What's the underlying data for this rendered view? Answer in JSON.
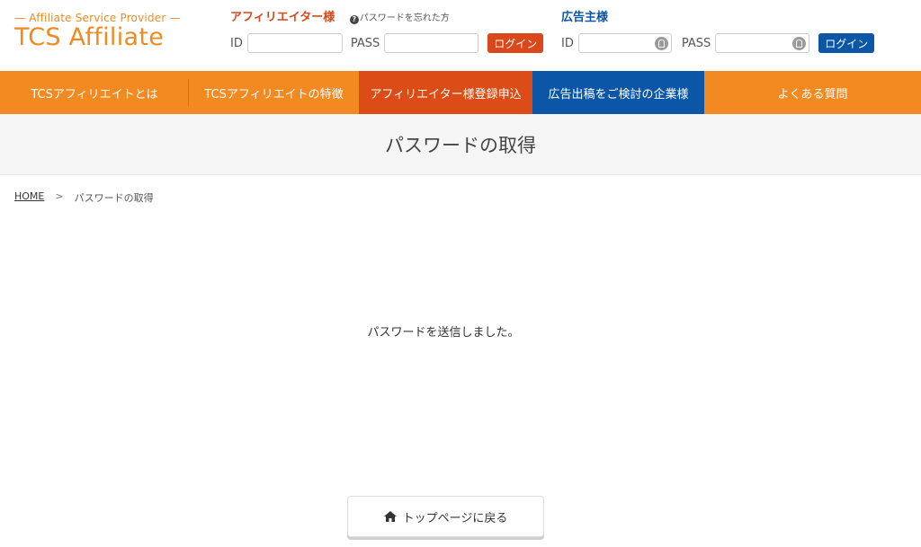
{
  "logo": {
    "sub": "— Affiliate Service Provider —",
    "main": "TCS Affiliate"
  },
  "affiliate_login": {
    "title": "アフィリエイター様",
    "forgot": "パスワードを忘れた方",
    "id_label": "ID",
    "pass_label": "PASS",
    "id_value": "",
    "pass_value": "",
    "login_label": "ログイン",
    "color": "#d9471a"
  },
  "advertiser_login": {
    "title": "広告主様",
    "id_label": "ID",
    "pass_label": "PASS",
    "id_value": "",
    "pass_value": "",
    "login_label": "ログイン",
    "color": "#0b56a6"
  },
  "nav": {
    "items": [
      {
        "label": "TCSアフィリエイトとは"
      },
      {
        "label": "TCSアフィリエイトの特徴"
      },
      {
        "label": "アフィリエイター様登録申込"
      },
      {
        "label": "広告出稿をご検討の企業様"
      },
      {
        "label": "よくある質問"
      }
    ],
    "color": "#f28a21",
    "active_color": "#dc4c16",
    "advertiser_color": "#0b56a6"
  },
  "page": {
    "title": "パスワードの取得",
    "breadcrumb_home": "HOME",
    "breadcrumb_sep": ">",
    "breadcrumb_current": "パスワードの取得",
    "message": "パスワードを送信しました。",
    "top_button_label": "トップページに戻る",
    "top_button_icon": "home-icon"
  }
}
